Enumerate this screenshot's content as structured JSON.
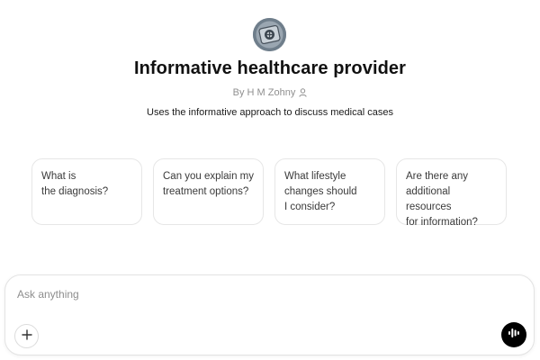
{
  "gpt": {
    "avatar_icon": "medical-logo-icon",
    "title": "Informative healthcare provider",
    "author": "By H M Zohny",
    "author_icon": "person-icon",
    "description": "Uses the informative approach to discuss medical cases"
  },
  "suggestions": [
    {
      "text": "What is\nthe diagnosis?"
    },
    {
      "text": "Can you explain my\ntreatment options?"
    },
    {
      "text": "What lifestyle\nchanges should\nI consider?"
    },
    {
      "text": "Are there any\nadditional resources\nfor information?"
    }
  ],
  "composer": {
    "placeholder": "Ask anything",
    "value": "",
    "plus_icon": "plus-icon",
    "voice_icon": "voice-mode-icon"
  },
  "colors": {
    "accent": "#000000",
    "card_border": "#e6e6e6",
    "muted_text": "#8f8f8f"
  }
}
